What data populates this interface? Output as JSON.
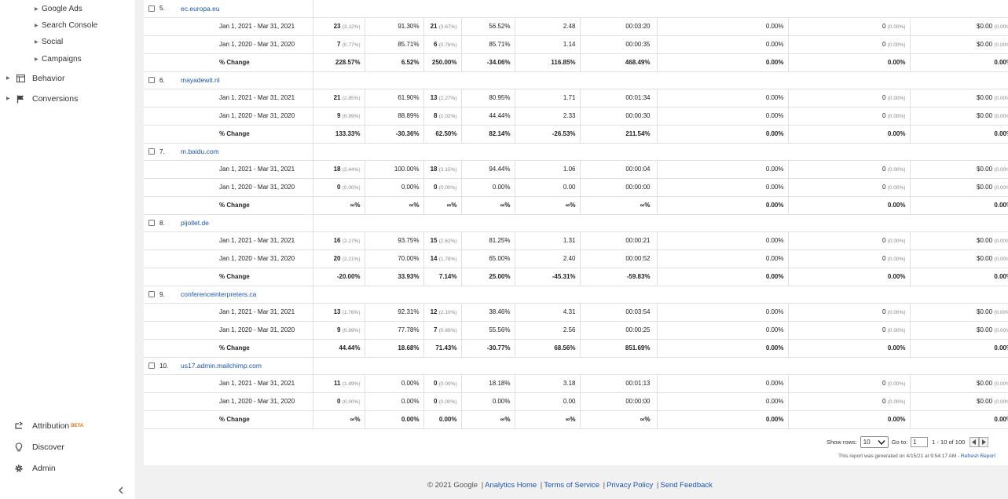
{
  "sidebar": {
    "sub_items": [
      "Google Ads",
      "Search Console",
      "Social",
      "Campaigns"
    ],
    "nav_items": [
      {
        "label": "Behavior",
        "icon": "behavior-icon"
      },
      {
        "label": "Conversions",
        "icon": "flag-icon"
      }
    ],
    "bottom_items": [
      {
        "label": "Attribution",
        "badge": "BETA",
        "icon": "attribution-icon"
      },
      {
        "label": "Discover",
        "icon": "lightbulb-icon"
      },
      {
        "label": "Admin",
        "icon": "gear-icon"
      }
    ]
  },
  "colors": {
    "link": "#1a56b0",
    "beta": "#e8710a",
    "accent": "#4285f4"
  },
  "table": {
    "rows": [
      {
        "index": "5.",
        "site": "ec.europa.eu",
        "sub": [
          {
            "period": "Jan 1, 2021 - Mar 31, 2021",
            "c1": "23",
            "c1p": "(3.12%)",
            "c2": "91.30%",
            "c3": "21",
            "c3p": "(3.67%)",
            "c4": "56.52%",
            "c5": "2.48",
            "c6": "00:03:20",
            "c7": "0.00%",
            "c8": "0",
            "c8p": "(0.00%)",
            "c9": "$0.00",
            "c9p": "(0.00%)"
          },
          {
            "period": "Jan 1, 2020 - Mar 31, 2020",
            "c1": "7",
            "c1p": "(0.77%)",
            "c2": "85.71%",
            "c3": "6",
            "c3p": "(0.76%)",
            "c4": "85.71%",
            "c5": "1.14",
            "c6": "00:00:35",
            "c7": "0.00%",
            "c8": "0",
            "c8p": "(0.00%)",
            "c9": "$0.00",
            "c9p": "(0.00%)"
          },
          {
            "period": "% Change",
            "c1": "228.57%",
            "c1p": "",
            "c2": "6.52%",
            "c3": "250.00%",
            "c3p": "",
            "c4": "-34.06%",
            "c5": "116.85%",
            "c6": "468.49%",
            "c7": "0.00%",
            "c8": "0.00%",
            "c8p": "",
            "c9": "0.00%",
            "c9p": ""
          }
        ]
      },
      {
        "index": "6.",
        "site": "mayadewit.nl",
        "sub": [
          {
            "period": "Jan 1, 2021 - Mar 31, 2021",
            "c1": "21",
            "c1p": "(2.85%)",
            "c2": "61.90%",
            "c3": "13",
            "c3p": "(2.27%)",
            "c4": "80.95%",
            "c5": "1.71",
            "c6": "00:01:34",
            "c7": "0.00%",
            "c8": "0",
            "c8p": "(0.00%)",
            "c9": "$0.00",
            "c9p": "(0.00%)"
          },
          {
            "period": "Jan 1, 2020 - Mar 31, 2020",
            "c1": "9",
            "c1p": "(0.99%)",
            "c2": "88.89%",
            "c3": "8",
            "c3p": "(1.02%)",
            "c4": "44.44%",
            "c5": "2.33",
            "c6": "00:00:30",
            "c7": "0.00%",
            "c8": "0",
            "c8p": "(0.00%)",
            "c9": "$0.00",
            "c9p": "(0.00%)"
          },
          {
            "period": "% Change",
            "c1": "133.33%",
            "c1p": "",
            "c2": "-30.36%",
            "c3": "62.50%",
            "c3p": "",
            "c4": "82.14%",
            "c5": "-26.53%",
            "c6": "211.54%",
            "c7": "0.00%",
            "c8": "0.00%",
            "c8p": "",
            "c9": "0.00%",
            "c9p": ""
          }
        ]
      },
      {
        "index": "7.",
        "site": "m.baidu.com",
        "sub": [
          {
            "period": "Jan 1, 2021 - Mar 31, 2021",
            "c1": "18",
            "c1p": "(2.44%)",
            "c2": "100.00%",
            "c3": "18",
            "c3p": "(3.15%)",
            "c4": "94.44%",
            "c5": "1.06",
            "c6": "00:00:04",
            "c7": "0.00%",
            "c8": "0",
            "c8p": "(0.00%)",
            "c9": "$0.00",
            "c9p": "(0.00%)"
          },
          {
            "period": "Jan 1, 2020 - Mar 31, 2020",
            "c1": "0",
            "c1p": "(0.00%)",
            "c2": "0.00%",
            "c3": "0",
            "c3p": "(0.00%)",
            "c4": "0.00%",
            "c5": "0.00",
            "c6": "00:00:00",
            "c7": "0.00%",
            "c8": "0",
            "c8p": "(0.00%)",
            "c9": "$0.00",
            "c9p": "(0.00%)"
          },
          {
            "period": "% Change",
            "c1": "∞%",
            "c1p": "",
            "c2": "∞%",
            "c3": "∞%",
            "c3p": "",
            "c4": "∞%",
            "c5": "∞%",
            "c6": "∞%",
            "c7": "0.00%",
            "c8": "0.00%",
            "c8p": "",
            "c9": "0.00%",
            "c9p": ""
          }
        ]
      },
      {
        "index": "8.",
        "site": "pijollet.de",
        "sub": [
          {
            "period": "Jan 1, 2021 - Mar 31, 2021",
            "c1": "16",
            "c1p": "(2.17%)",
            "c2": "93.75%",
            "c3": "15",
            "c3p": "(2.62%)",
            "c4": "81.25%",
            "c5": "1.31",
            "c6": "00:00:21",
            "c7": "0.00%",
            "c8": "0",
            "c8p": "(0.00%)",
            "c9": "$0.00",
            "c9p": "(0.00%)"
          },
          {
            "period": "Jan 1, 2020 - Mar 31, 2020",
            "c1": "20",
            "c1p": "(2.21%)",
            "c2": "70.00%",
            "c3": "14",
            "c3p": "(1.78%)",
            "c4": "65.00%",
            "c5": "2.40",
            "c6": "00:00:52",
            "c7": "0.00%",
            "c8": "0",
            "c8p": "(0.00%)",
            "c9": "$0.00",
            "c9p": "(0.00%)"
          },
          {
            "period": "% Change",
            "c1": "-20.00%",
            "c1p": "",
            "c2": "33.93%",
            "c3": "7.14%",
            "c3p": "",
            "c4": "25.00%",
            "c5": "-45.31%",
            "c6": "-59.83%",
            "c7": "0.00%",
            "c8": "0.00%",
            "c8p": "",
            "c9": "0.00%",
            "c9p": ""
          }
        ]
      },
      {
        "index": "9.",
        "site": "conferenceinterpreters.ca",
        "sub": [
          {
            "period": "Jan 1, 2021 - Mar 31, 2021",
            "c1": "13",
            "c1p": "(1.76%)",
            "c2": "92.31%",
            "c3": "12",
            "c3p": "(2.10%)",
            "c4": "38.46%",
            "c5": "4.31",
            "c6": "00:03:54",
            "c7": "0.00%",
            "c8": "0",
            "c8p": "(0.00%)",
            "c9": "$0.00",
            "c9p": "(0.00%)"
          },
          {
            "period": "Jan 1, 2020 - Mar 31, 2020",
            "c1": "9",
            "c1p": "(0.99%)",
            "c2": "77.78%",
            "c3": "7",
            "c3p": "(0.89%)",
            "c4": "55.56%",
            "c5": "2.56",
            "c6": "00:00:25",
            "c7": "0.00%",
            "c8": "0",
            "c8p": "(0.00%)",
            "c9": "$0.00",
            "c9p": "(0.00%)"
          },
          {
            "period": "% Change",
            "c1": "44.44%",
            "c1p": "",
            "c2": "18.68%",
            "c3": "71.43%",
            "c3p": "",
            "c4": "-30.77%",
            "c5": "68.56%",
            "c6": "851.69%",
            "c7": "0.00%",
            "c8": "0.00%",
            "c8p": "",
            "c9": "0.00%",
            "c9p": ""
          }
        ]
      },
      {
        "index": "10.",
        "site": "us17.admin.mailchimp.com",
        "sub": [
          {
            "period": "Jan 1, 2021 - Mar 31, 2021",
            "c1": "11",
            "c1p": "(1.49%)",
            "c2": "0.00%",
            "c3": "0",
            "c3p": "(0.00%)",
            "c4": "18.18%",
            "c5": "3.18",
            "c6": "00:01:13",
            "c7": "0.00%",
            "c8": "0",
            "c8p": "(0.00%)",
            "c9": "$0.00",
            "c9p": "(0.00%)"
          },
          {
            "period": "Jan 1, 2020 - Mar 31, 2020",
            "c1": "0",
            "c1p": "(0.00%)",
            "c2": "0.00%",
            "c3": "0",
            "c3p": "(0.00%)",
            "c4": "0.00%",
            "c5": "0.00",
            "c6": "00:00:00",
            "c7": "0.00%",
            "c8": "0",
            "c8p": "(0.00%)",
            "c9": "$0.00",
            "c9p": "(0.00%)"
          },
          {
            "period": "% Change",
            "c1": "∞%",
            "c1p": "",
            "c2": "0.00%",
            "c3": "0.00%",
            "c3p": "",
            "c4": "∞%",
            "c5": "∞%",
            "c6": "∞%",
            "c7": "0.00%",
            "c8": "0.00%",
            "c8p": "",
            "c9": "0.00%",
            "c9p": ""
          }
        ]
      }
    ]
  },
  "controls": {
    "show_rows_label": "Show rows:",
    "show_rows_value": "10",
    "goto_label": "Go to:",
    "goto_value": "1",
    "range": "1 - 10 of 100"
  },
  "report": {
    "generated_text": "This report was generated on 4/15/21 at 9:54:17 AM -",
    "refresh_label": "Refresh Report"
  },
  "footer": {
    "copyright": "© 2021 Google",
    "links": [
      "Analytics Home",
      "Terms of Service",
      "Privacy Policy",
      "Send Feedback"
    ]
  }
}
